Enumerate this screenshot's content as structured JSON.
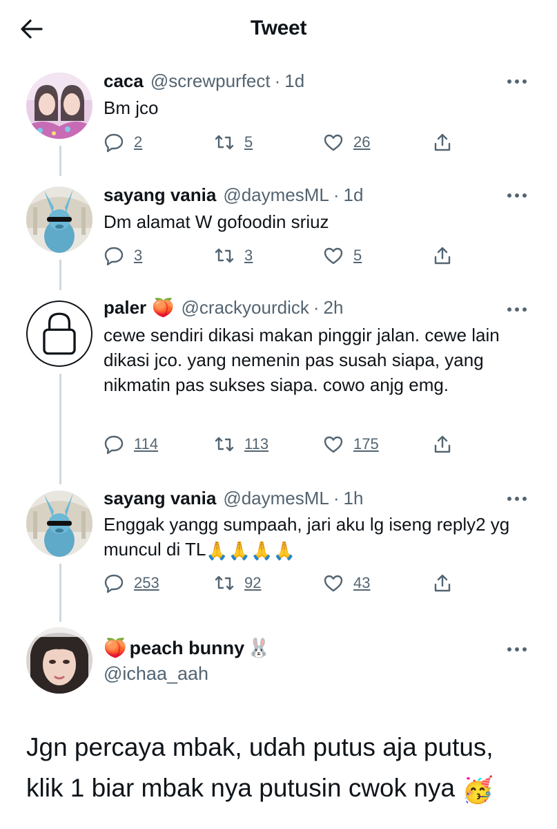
{
  "header": {
    "title": "Tweet"
  },
  "icons": {
    "back": "arrow-left-icon",
    "reply": "reply-icon",
    "retweet": "retweet-icon",
    "like": "heart-icon",
    "share": "share-icon",
    "more": "more-icon",
    "lock": "lock-icon"
  },
  "thread": [
    {
      "name": "caca",
      "handle": "@screwpurfect",
      "time": "1d",
      "text": "Bm jco",
      "replies": "2",
      "retweets": "5",
      "likes": "26"
    },
    {
      "name": "sayang vania",
      "handle": "@daymesML",
      "time": "1d",
      "text": "Dm alamat W gofoodin sriuz",
      "replies": "3",
      "retweets": "3",
      "likes": "5"
    },
    {
      "name": "paler",
      "name_emoji": "🍑",
      "handle": "@crackyourdick",
      "time": "2h",
      "text": "cewe sendiri dikasi makan pinggir jalan. cewe lain dikasi jco. yang nemenin pas susah siapa, yang nikmatin pas sukses siapa. cowo anjg emg.",
      "replies": "114",
      "retweets": "113",
      "likes": "175"
    },
    {
      "name": "sayang vania",
      "handle": "@daymesML",
      "time": "1h",
      "text": "Enggak yangg sumpaah, jari aku lg iseng reply2 yg muncul di TL",
      "text_emoji": "🙏🙏🙏🙏",
      "replies": "253",
      "retweets": "92",
      "likes": "43"
    }
  ],
  "main_tweet": {
    "name_prefix_emoji": "🍑",
    "name": "peach bunny",
    "name_suffix_emoji": "🐰",
    "handle": "@ichaa_aah",
    "text": "Jgn percaya mbak, udah putus aja putus, klik 1 biar mbak nya putusin cwok nya",
    "text_emoji": "🥳"
  }
}
